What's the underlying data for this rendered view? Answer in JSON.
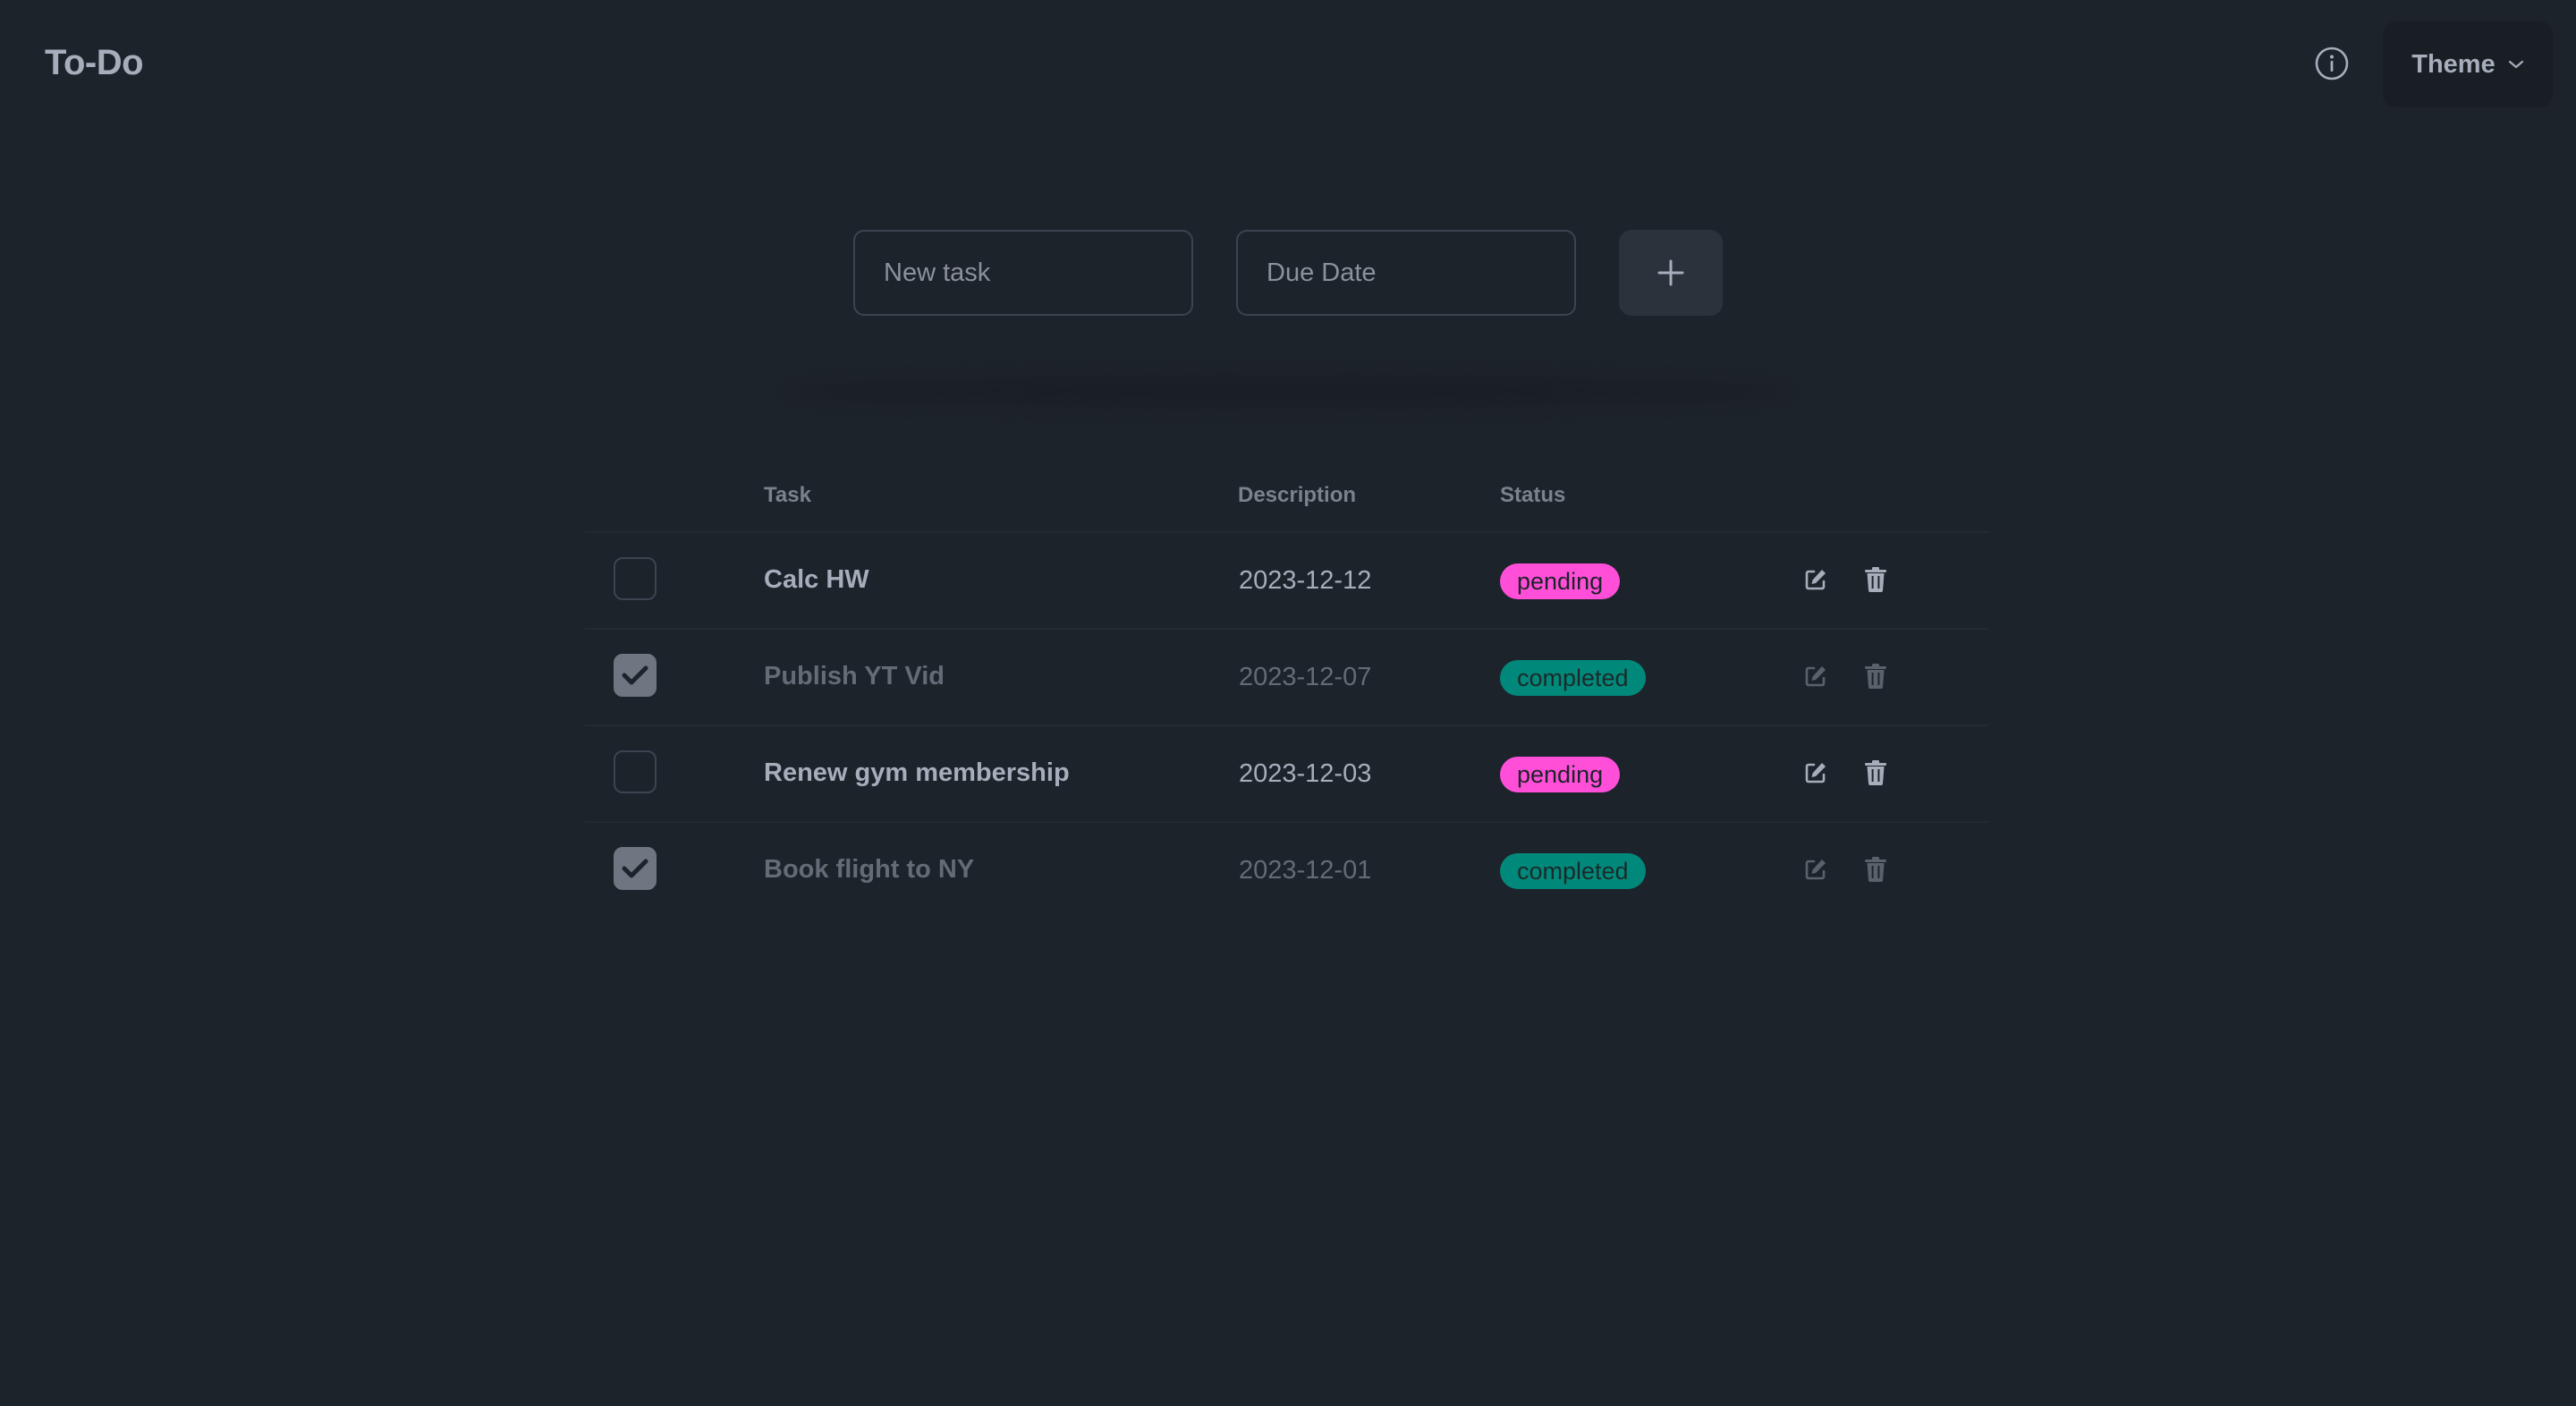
{
  "app": {
    "title": "To-Do"
  },
  "navbar": {
    "info_icon": "info-circle-icon",
    "theme_label": "Theme",
    "theme_icon": "chevron-down-icon"
  },
  "form": {
    "task_placeholder": "New task",
    "date_placeholder": "Due Date",
    "add_icon": "plus-icon"
  },
  "table": {
    "headers": {
      "task": "Task",
      "description": "Description",
      "status": "Status"
    },
    "rows": [
      {
        "task": "Calc HW",
        "date": "2023-12-12",
        "status": "pending",
        "checked": false
      },
      {
        "task": "Publish YT Vid",
        "date": "2023-12-07",
        "status": "completed",
        "checked": true
      },
      {
        "task": "Renew gym membership",
        "date": "2023-12-03",
        "status": "pending",
        "checked": false
      },
      {
        "task": "Book flight to NY",
        "date": "2023-12-01",
        "status": "completed",
        "checked": true
      }
    ]
  },
  "colors": {
    "background": "#1d232a",
    "text": "#a6adbb",
    "pending": "#ff4fd8",
    "completed": "#00897b"
  }
}
